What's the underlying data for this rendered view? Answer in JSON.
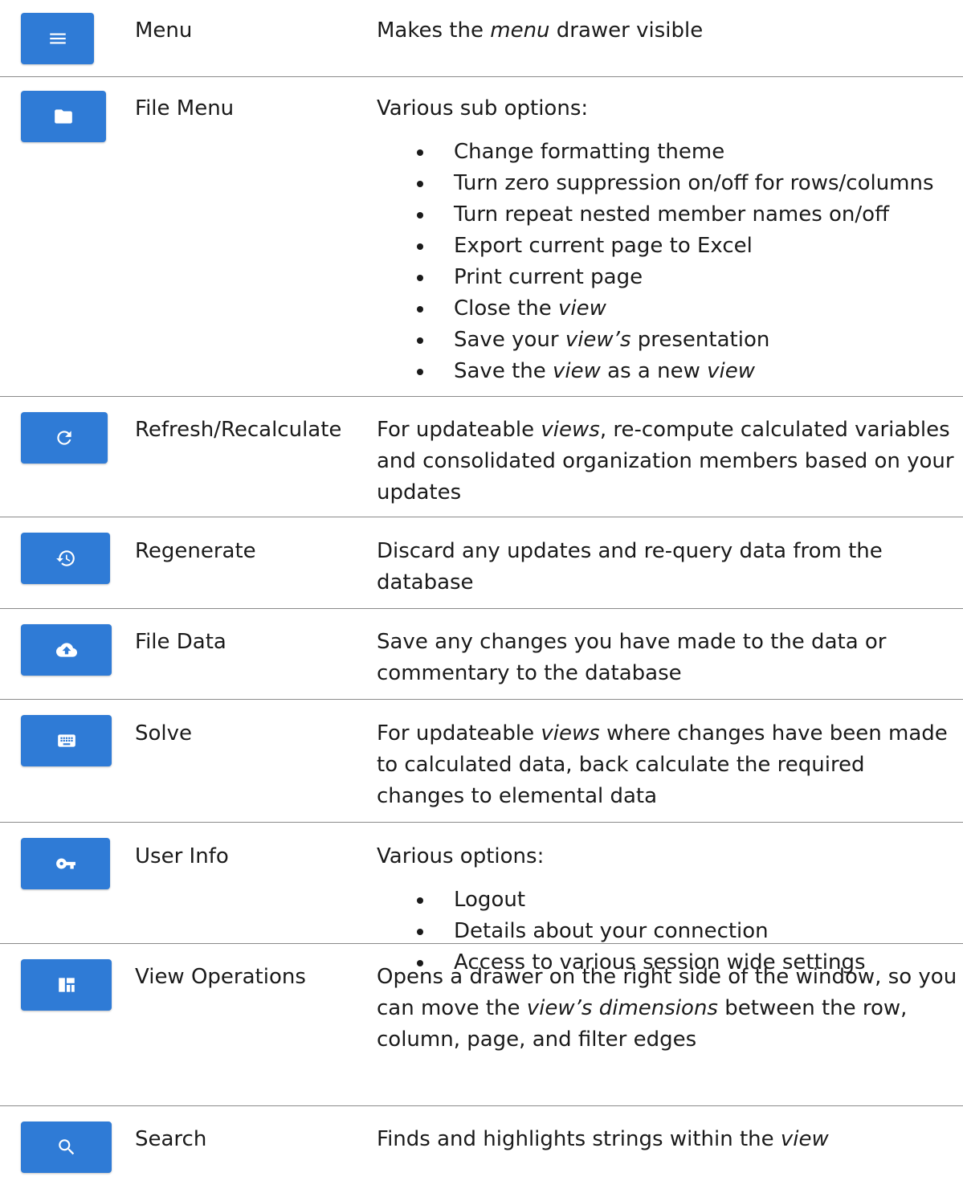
{
  "rows": [
    {
      "icon": "menu-icon",
      "label": "Menu",
      "segments": [
        [
          "Makes the ",
          false
        ],
        [
          "menu",
          true
        ],
        [
          " drawer visible",
          false
        ]
      ],
      "bullets": []
    },
    {
      "icon": "folder-icon",
      "label": "File Menu",
      "segments": [
        [
          "Various sub options:",
          false
        ]
      ],
      "bullets": [
        [
          [
            "Change formatting theme",
            false
          ]
        ],
        [
          [
            "Turn zero suppression on/off for rows/columns",
            false
          ]
        ],
        [
          [
            "Turn repeat nested member names on/off",
            false
          ]
        ],
        [
          [
            "Export current page to Excel",
            false
          ]
        ],
        [
          [
            "Print current page",
            false
          ]
        ],
        [
          [
            "Close the ",
            false
          ],
          [
            "view",
            true
          ]
        ],
        [
          [
            "Save your ",
            false
          ],
          [
            "view’s",
            true
          ],
          [
            " presentation",
            false
          ]
        ],
        [
          [
            "Save the ",
            false
          ],
          [
            "view",
            true
          ],
          [
            " as a new ",
            false
          ],
          [
            "view",
            true
          ]
        ]
      ]
    },
    {
      "icon": "refresh-icon",
      "label": "Refresh/Recalculate",
      "segments": [
        [
          "For updateable ",
          false
        ],
        [
          "views",
          true
        ],
        [
          ", re-compute calculated variables and consolidated organization members based on your updates",
          false
        ]
      ],
      "bullets": []
    },
    {
      "icon": "history-icon",
      "label": "Regenerate",
      "segments": [
        [
          "Discard any updates and re-query data from the database",
          false
        ]
      ],
      "bullets": []
    },
    {
      "icon": "cloud-upload-icon",
      "label": "File Data",
      "segments": [
        [
          "Save any changes you have made to the data or commentary to the database",
          false
        ]
      ],
      "bullets": []
    },
    {
      "icon": "keyboard-icon",
      "label": "Solve",
      "segments": [
        [
          "For updateable ",
          false
        ],
        [
          "views",
          true
        ],
        [
          " where changes have been made to calculated data, back calculate the required changes to elemental data",
          false
        ]
      ],
      "bullets": []
    },
    {
      "icon": "key-icon",
      "label": "User Info",
      "segments": [
        [
          "Various options:",
          false
        ]
      ],
      "bullets": [
        [
          [
            "Logout",
            false
          ]
        ],
        [
          [
            "Details about your connection",
            false
          ]
        ],
        [
          [
            "Access to various session wide settings",
            false
          ]
        ]
      ]
    },
    {
      "icon": "dashboard-icon",
      "label": "View Operations",
      "segments": [
        [
          "Opens a drawer on the right side of the window, so you can move the ",
          false
        ],
        [
          "view’s dimensions",
          true
        ],
        [
          " between the row, column, page, and filter edges",
          false
        ]
      ],
      "bullets": []
    },
    {
      "icon": "search-icon",
      "label": "Search",
      "segments": [
        [
          "Finds and highlights strings within the ",
          false
        ],
        [
          "view",
          true
        ]
      ],
      "bullets": []
    }
  ]
}
